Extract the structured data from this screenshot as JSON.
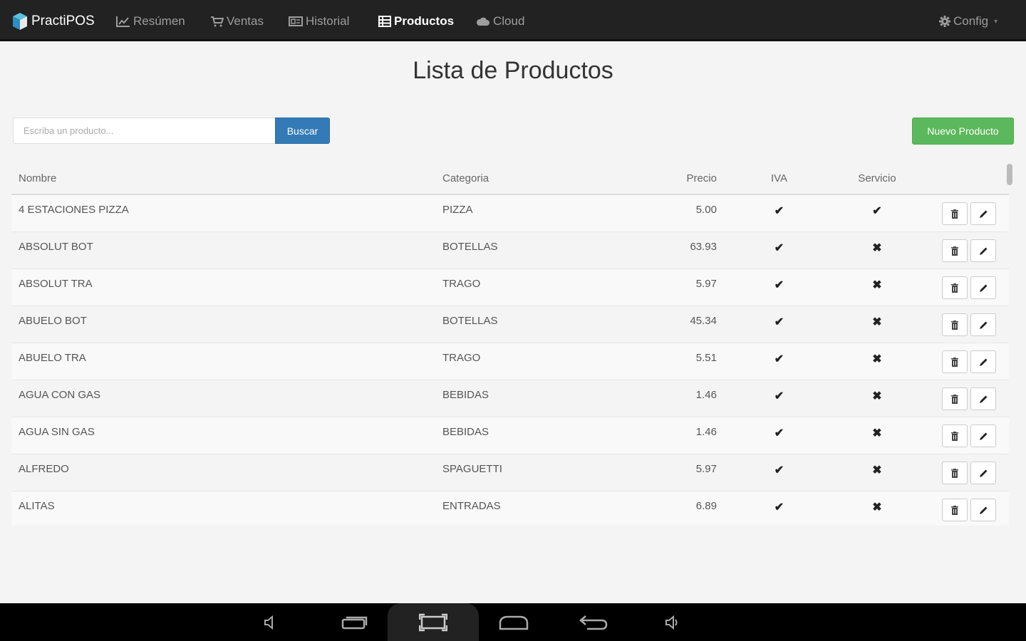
{
  "brand": {
    "name": "PractiPOS",
    "logo_icon": "practipos-logo-icon"
  },
  "nav": {
    "items": [
      {
        "label": "Resúmen",
        "icon": "chart-icon",
        "active": false
      },
      {
        "label": "Ventas",
        "icon": "cart-icon",
        "active": false
      },
      {
        "label": "Historial",
        "icon": "history-icon",
        "active": false
      },
      {
        "label": "Productos",
        "icon": "list-icon",
        "active": true
      },
      {
        "label": "Cloud",
        "icon": "cloud-icon",
        "active": false
      }
    ],
    "config_label": "Config"
  },
  "page": {
    "title": "Lista de Productos"
  },
  "search": {
    "placeholder": "Escriba un producto...",
    "button_label": "Buscar"
  },
  "new_product_label": "Nuevo Producto",
  "table": {
    "headers": {
      "name": "Nombre",
      "category": "Categoria",
      "price": "Precio",
      "iva": "IVA",
      "service": "Servicio"
    },
    "rows": [
      {
        "name": "4 ESTACIONES PIZZA",
        "category": "PIZZA",
        "price": "5.00",
        "iva": true,
        "service": true
      },
      {
        "name": "ABSOLUT BOT",
        "category": "BOTELLAS",
        "price": "63.93",
        "iva": true,
        "service": false
      },
      {
        "name": "ABSOLUT TRA",
        "category": "TRAGO",
        "price": "5.97",
        "iva": true,
        "service": false
      },
      {
        "name": "ABUELO BOT",
        "category": "BOTELLAS",
        "price": "45.34",
        "iva": true,
        "service": false
      },
      {
        "name": "ABUELO TRA",
        "category": "TRAGO",
        "price": "5.51",
        "iva": true,
        "service": false
      },
      {
        "name": "AGUA CON GAS",
        "category": "BEBIDAS",
        "price": "1.46",
        "iva": true,
        "service": false
      },
      {
        "name": "AGUA SIN GAS",
        "category": "BEBIDAS",
        "price": "1.46",
        "iva": true,
        "service": false
      },
      {
        "name": "ALFREDO",
        "category": "SPAGUETTI",
        "price": "5.97",
        "iva": true,
        "service": false
      },
      {
        "name": "ALITAS",
        "category": "ENTRADAS",
        "price": "6.89",
        "iva": true,
        "service": false
      }
    ]
  },
  "marks": {
    "check": "✔",
    "cross": "✖"
  },
  "colors": {
    "navbar": "#222222",
    "primary": "#337ab7",
    "success": "#5cb85c"
  }
}
